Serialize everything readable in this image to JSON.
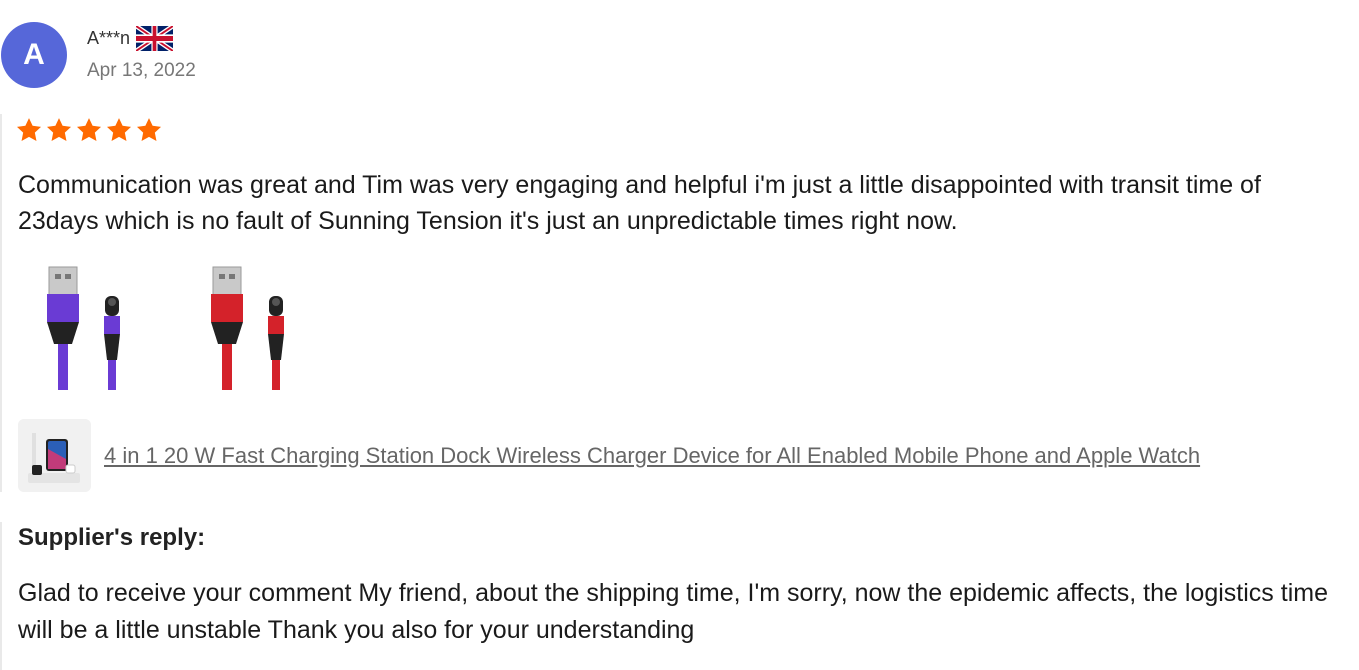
{
  "reviewer": {
    "avatar_letter": "A",
    "name": "A***n",
    "country_flag_icon": "uk-flag-icon",
    "date": "Apr 13, 2022"
  },
  "rating": {
    "stars": 5,
    "max_stars": 5,
    "color": "#ff6a00"
  },
  "review_text": "Communication was great and Tim was very engaging and helpful i'm just a little disappointed with transit time of 23days which is no fault of Sunning Tension it's just an unpredictable times right now.",
  "photos": [
    {
      "icon": "purple-magnetic-cable-photo",
      "color": "#6a3bd4"
    },
    {
      "icon": "red-magnetic-cable-photo",
      "color": "#d4222a"
    }
  ],
  "product": {
    "thumb_icon": "charging-station-thumbnail",
    "title": "4 in 1 20 W Fast Charging Station Dock Wireless Charger Device for All Enabled Mobile Phone and Apple Watch"
  },
  "supplier_reply": {
    "heading": "Supplier's reply:",
    "text": "Glad to receive your comment My friend, about the shipping time, I'm sorry, now the epidemic affects, the logistics time will be a little unstable Thank you also for your understanding"
  }
}
